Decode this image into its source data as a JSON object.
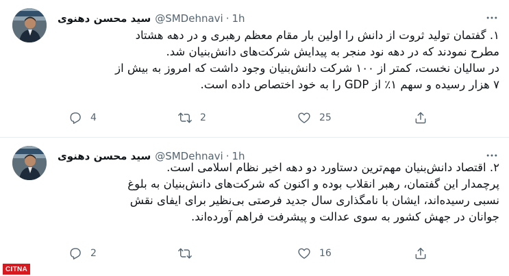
{
  "tweets": [
    {
      "author_name": "سید محسن دهنوی",
      "handle": "@SMDehnavi",
      "separator": "·",
      "time": "1h",
      "lines": [
        "۱. گفتمان تولید ثروت از دانش را اولین بار مقام معظم رهبری و در دهه هشتاد",
        "مطرح نمودند که در دهه نود منجر به پیدایش شرکت‌های دانش‌بنیان شد.",
        "در سالیان نخست، کمتر از ۱۰۰ شرکت دانش‌بنیان وجود داشت که امروز به بیش از",
        "۷ هزار رسیده و سهم ۱٪ از GDP را به خود اختصاص داده است."
      ],
      "reply_count": "4",
      "retweet_count": "2",
      "like_count": "25"
    },
    {
      "author_name": "سید محسن دهنوی",
      "handle": "@SMDehnavi",
      "separator": "·",
      "time": "1h",
      "lines": [
        "۲. اقتصاد دانش‌بنیان مهم‌ترین دستاورد دو دهه اخیر نظام اسلامی است.",
        "پرچمدار این گفتمان، رهبر انقلاب بوده و اکنون که شرکت‌های دانش‌بنیان به بلوغ",
        "نسبی رسیده‌اند، ایشان با نامگذاری سال جدید فرصتی بی‌نظیر برای ایفای نقش",
        "جوانان در جهش کشور به سوی عدالت و پیشرفت فراهم آورده‌اند."
      ],
      "reply_count": "2",
      "retweet_count": "",
      "like_count": "16"
    }
  ],
  "watermark": "CITNA",
  "colors": {
    "text": "#0f1419",
    "secondary": "#536471",
    "divider": "#e6ecf0",
    "watermark_bg": "#d71920"
  },
  "icons": {
    "more": "more-icon",
    "reply": "reply-icon",
    "retweet": "retweet-icon",
    "like": "heart-icon",
    "share": "share-icon"
  }
}
